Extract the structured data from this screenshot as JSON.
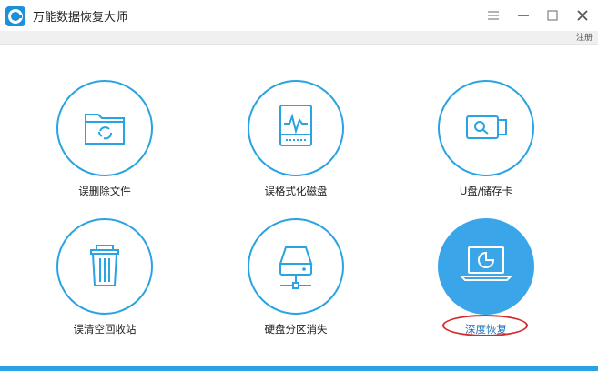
{
  "app": {
    "title": "万能数据恢复大师",
    "register_label": "注册"
  },
  "colors": {
    "accent": "#29a3e2",
    "active_fill": "#3aa6e9",
    "highlight_ring": "#d62b2b"
  },
  "tiles": [
    {
      "label": "误删除文件",
      "icon": "recycle-folder-icon"
    },
    {
      "label": "误格式化磁盘",
      "icon": "disk-format-icon"
    },
    {
      "label": "U盘/储存卡",
      "icon": "usb-drive-icon"
    },
    {
      "label": "误清空回收站",
      "icon": "trash-bin-icon"
    },
    {
      "label": "硬盘分区消失",
      "icon": "hard-drive-partition-icon"
    },
    {
      "label": "深度恢复",
      "icon": "laptop-deep-scan-icon",
      "active": true
    }
  ]
}
